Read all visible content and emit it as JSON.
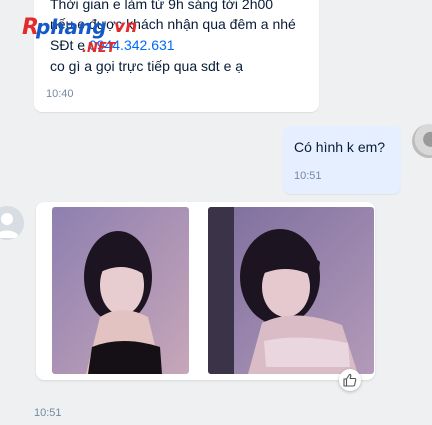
{
  "incoming_message": {
    "lines": [
      "Thời gian e làm từ 9h sáng tới 2h00",
      "nếu e được khách nhận qua đêm a nhé",
      "SĐt e ",
      "co gì a gọi trực tiếp qua sdt e ạ"
    ],
    "phone": "0944.342.631",
    "time": "10:40"
  },
  "outgoing_message": {
    "text": "Có hình k em?",
    "time": "10:51"
  },
  "photo_message": {
    "photos": [
      {
        "alt": "photo-1"
      },
      {
        "alt": "photo-2"
      }
    ],
    "time": "10:51"
  },
  "watermark": {
    "brand_main": "Rphang",
    "brand_vn": "vn",
    "brand_net": ".NET"
  },
  "colors": {
    "background": "#eef0f1",
    "incoming_bubble": "#ffffff",
    "outgoing_bubble": "#e5efff",
    "link": "#0068ff",
    "time": "#7589a3"
  }
}
